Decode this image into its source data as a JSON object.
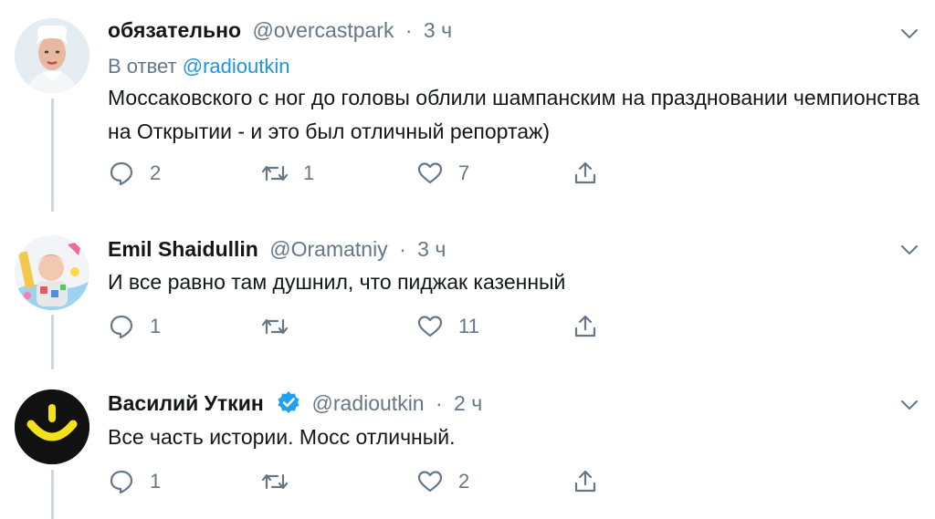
{
  "tweets": [
    {
      "name": "обязательно",
      "handle": "@overcastpark",
      "dot": "·",
      "time": "3 ч",
      "reply_prefix": "В ответ",
      "reply_mention": "@radioutkin",
      "text": "Моссаковского с ног до головы облили шампанским на праздновании чемпионства на Открытии - и это был отличный репортаж)",
      "replies": "2",
      "retweets": "1",
      "likes": "7"
    },
    {
      "name": "Emil Shaidullin",
      "handle": "@Oramatniy",
      "dot": "·",
      "time": "3 ч",
      "text": "И все равно там душнил, что пиджак казенный",
      "replies": "1",
      "retweets": "",
      "likes": "11"
    },
    {
      "name": "Василий Уткин",
      "handle": "@radioutkin",
      "dot": "·",
      "time": "2 ч",
      "verified": true,
      "text": "Все часть истории. Мосс отличный.",
      "replies": "1",
      "retweets": "",
      "likes": "2"
    }
  ],
  "colors": {
    "text": "#14171a",
    "muted": "#657786",
    "link": "#1b95e0",
    "thread_line": "#ccd6dd",
    "verified": "#1da1f2",
    "avatar3_bg": "#111111",
    "avatar3_accent": "#f5e11a"
  },
  "icons": [
    "reply-icon",
    "retweet-icon",
    "like-icon",
    "share-icon",
    "chevron-down-icon",
    "verified-badge-icon"
  ]
}
